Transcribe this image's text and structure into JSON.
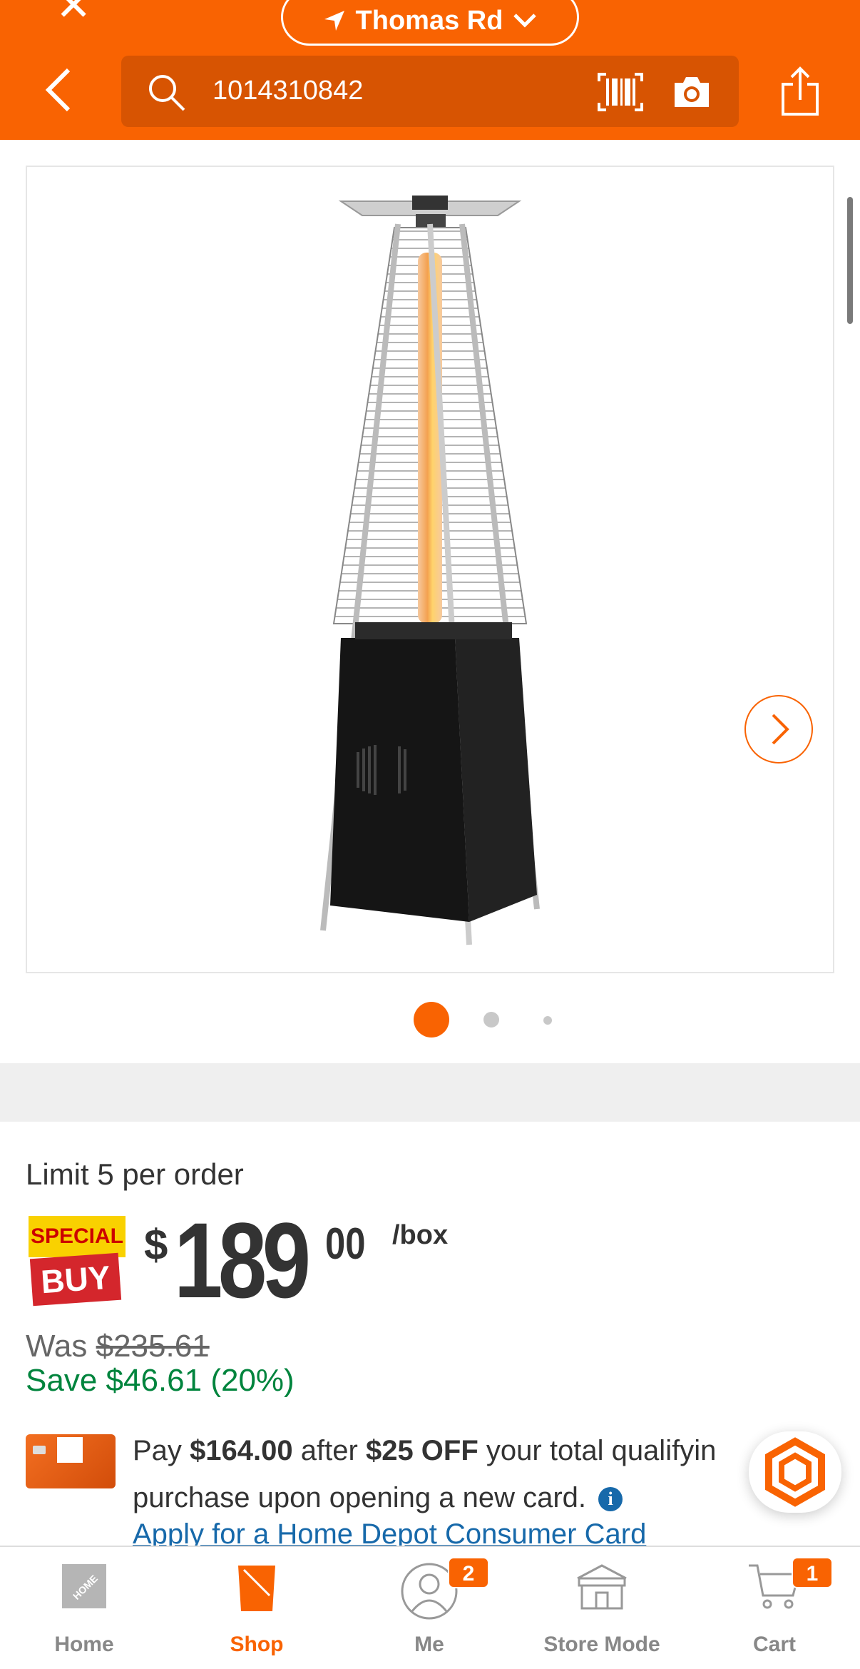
{
  "header": {
    "location": "Thomas Rd",
    "search_value": "1014310842",
    "icons": [
      "close-icon",
      "location-arrow-icon",
      "chevron-down-icon",
      "back-icon",
      "search-icon",
      "barcode-icon",
      "camera-icon",
      "share-icon"
    ],
    "color": "#f96302"
  },
  "gallery": {
    "image_count": 3,
    "active_index": 0,
    "next_icon": "chevron-right-icon"
  },
  "product": {
    "limit": "Limit 5 per order",
    "badge_top": "SPECIAL",
    "badge_bottom": "BUY",
    "price_symbol": "$",
    "price_dollars": "189",
    "price_cents": "00",
    "price_unit": "/box",
    "was_label": "Was",
    "was_price": "$235.61",
    "save_text": "Save $46.61 (20%)"
  },
  "promo": {
    "pay_prefix": "Pay",
    "pay_amount": "$164.00",
    "after": "after",
    "off_amount": "$25 OFF",
    "rest_line1": "your total qualifyin",
    "line2": "purchase upon opening a new card.",
    "apply_link": "Apply for a Home Depot Consumer Card"
  },
  "bottom_nav": {
    "items": [
      {
        "label": "Home",
        "icon": "home-depot-logo-icon"
      },
      {
        "label": "Shop",
        "icon": "shop-bucket-icon",
        "active": true
      },
      {
        "label": "Me",
        "icon": "user-icon",
        "badge": "2"
      },
      {
        "label": "Store Mode",
        "icon": "store-icon"
      },
      {
        "label": "Cart",
        "icon": "cart-icon",
        "badge": "1"
      }
    ]
  }
}
